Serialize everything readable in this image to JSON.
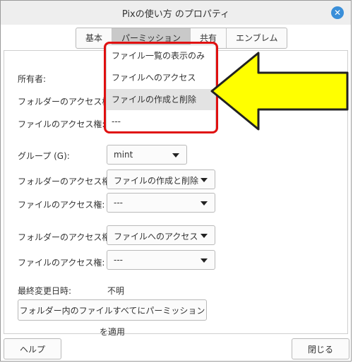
{
  "window": {
    "title": "Pixの使い方 のプロパティ",
    "close_glyph": "✕"
  },
  "tabs": [
    {
      "label": "基本"
    },
    {
      "label": "パーミッション"
    },
    {
      "label": "共有"
    },
    {
      "label": "エンブレム"
    }
  ],
  "owner": {
    "owner_label": "所有者:",
    "folder_access_label": "フォルダーのアクセス権:",
    "file_access_label": "ファイルのアクセス権:"
  },
  "owner_dropdown": {
    "options": [
      "ファイル一覧の表示のみ",
      "ファイルへのアクセス",
      "ファイルの作成と削除",
      "---"
    ],
    "highlighted_index": 2
  },
  "group": {
    "label": "グループ (G):",
    "value": "mint",
    "folder_access_label": "フォルダーのアクセス権:",
    "folder_access_value": "ファイルの作成と削除",
    "file_access_label": "ファイルのアクセス権:",
    "file_access_value": "---"
  },
  "others": {
    "folder_access_label": "フォルダーのアクセス権:",
    "folder_access_value": "ファイルへのアクセス",
    "file_access_label": "ファイルのアクセス権:",
    "file_access_value": "---"
  },
  "last_modified": {
    "label": "最終変更日時:",
    "value": "不明"
  },
  "apply_button": "フォルダー内のファイルすべてにパーミッションを適用",
  "buttons": {
    "help": "ヘルプ",
    "close": "閉じる"
  },
  "colors": {
    "annotation_arrow": "#ffff00",
    "annotation_box": "#e01010",
    "close_button": "#3a8fd9"
  }
}
